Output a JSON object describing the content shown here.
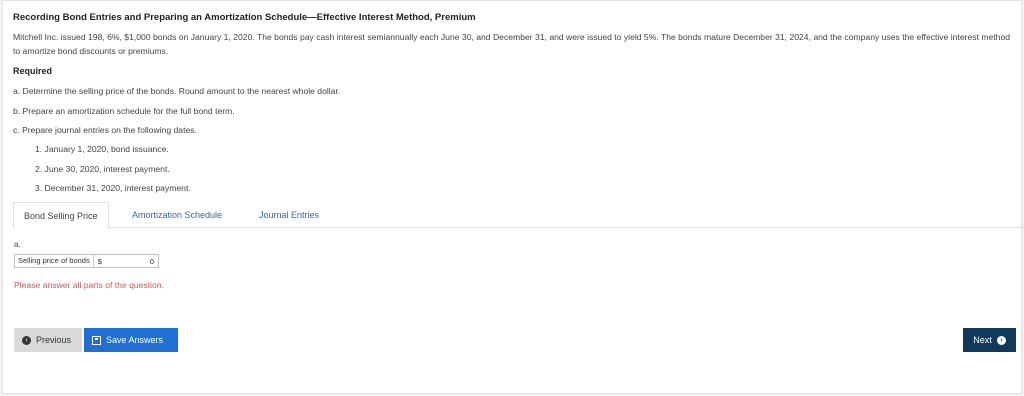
{
  "problem": {
    "title": "Recording Bond Entries and Preparing an Amortization Schedule—Effective Interest Method, Premium",
    "description": "Mitchell Inc. issued 198, 6%, $1,000 bonds on January 1, 2020. The bonds pay cash interest semiannually each June 30, and December 31, and were issued to yield 5%. The bonds mature December 31, 2024, and the company uses the effective interest method to amortize bond discounts or premiums.",
    "required_label": "Required",
    "parts": [
      "a. Determine the selling price of the bonds. Round amount to the nearest whole dollar.",
      "b. Prepare an amortization schedule for the full bond term.",
      "c. Prepare journal entries on the following dates."
    ],
    "subparts": [
      "1. January 1, 2020, bond issuance.",
      "2. June 30, 2020, interest payment.",
      "3. December 31, 2020, interest payment."
    ]
  },
  "tabs": [
    "Bond Selling Price",
    "Amortization Schedule",
    "Journal Entries"
  ],
  "answer": {
    "part_label": "a.",
    "field_label": "Selling price of bonds",
    "currency": "$",
    "value": "0"
  },
  "warning": "Please answer all parts of the question.",
  "buttons": {
    "previous": "Previous",
    "save": "Save Answers",
    "next": "Next"
  },
  "colors": {
    "link": "#2a6bb0",
    "warning": "#d9534f",
    "save_button": "#1f6fd4",
    "next_button": "#103a5c"
  }
}
